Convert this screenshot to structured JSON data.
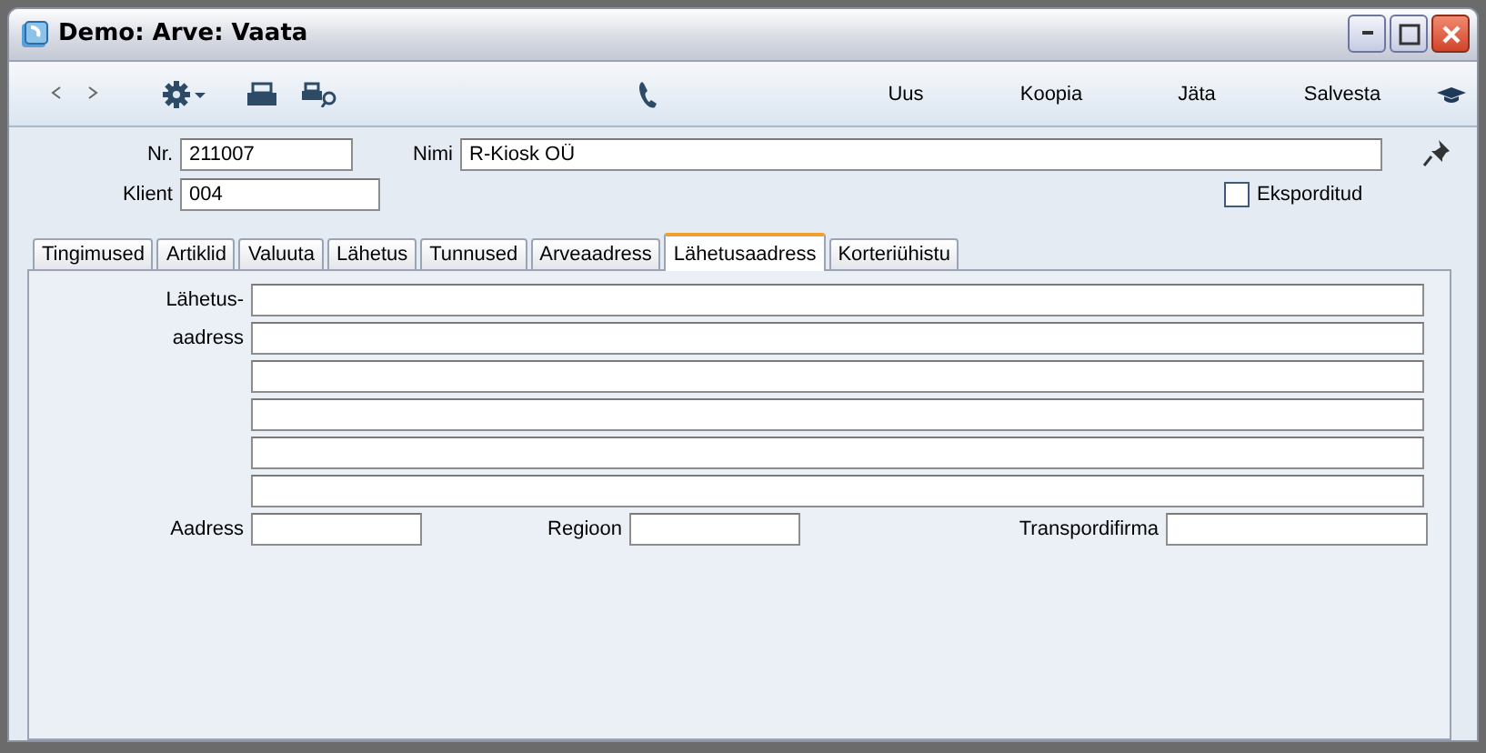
{
  "window": {
    "title": "Demo: Arve: Vaata"
  },
  "toolbar": {
    "buttons": [
      "Uus",
      "Koopia",
      "Jäta",
      "Salvesta"
    ]
  },
  "header": {
    "nr": {
      "label": "Nr.",
      "value": "211007"
    },
    "nimi": {
      "label": "Nimi",
      "value": "R-Kiosk OÜ"
    },
    "klient": {
      "label": "Klient",
      "value": "004"
    },
    "exported": {
      "label": "Eksporditud",
      "checked": false
    }
  },
  "tabs": [
    {
      "label": "Tingimused",
      "selected": false
    },
    {
      "label": "Artiklid",
      "selected": false
    },
    {
      "label": "Valuuta",
      "selected": false
    },
    {
      "label": "Lähetus",
      "selected": false
    },
    {
      "label": "Tunnused",
      "selected": false
    },
    {
      "label": "Arveaadress",
      "selected": false
    },
    {
      "label": "Lähetusaadress",
      "selected": true
    },
    {
      "label": "Korteriühistu",
      "selected": false
    }
  ],
  "address": {
    "label_lines": [
      "Lähetus-",
      "aadress"
    ]
  },
  "bottom_fields": [
    {
      "label": "Aadress"
    },
    {
      "label": "Regioon"
    },
    {
      "label": "Transpordifirma"
    }
  ]
}
